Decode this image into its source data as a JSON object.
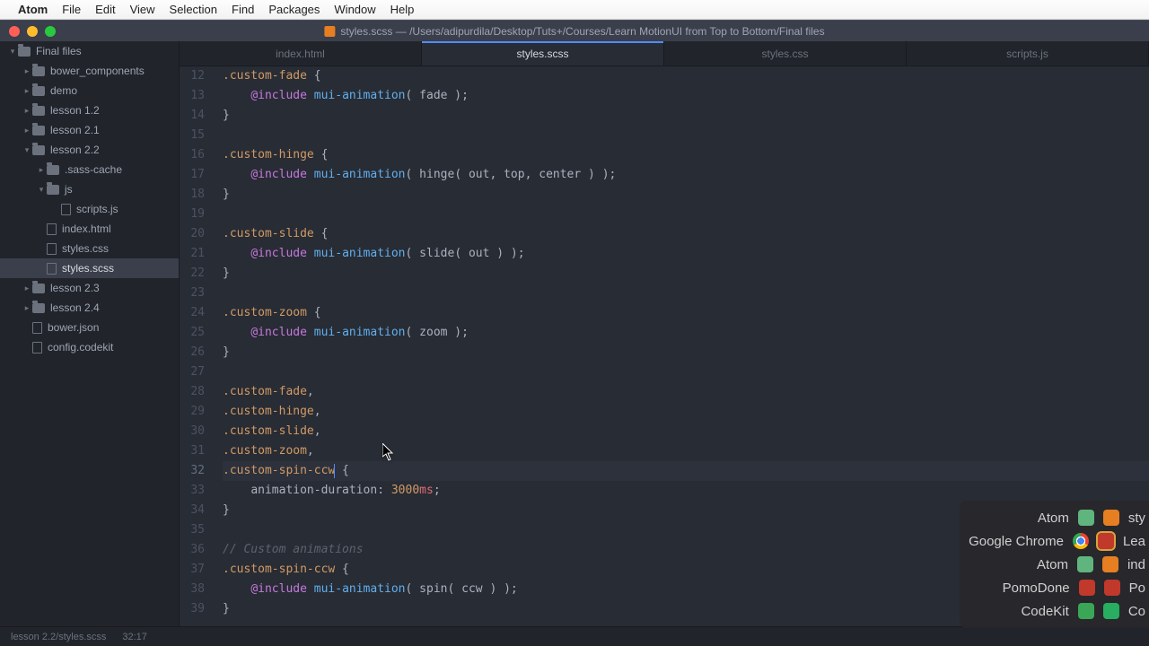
{
  "menubar": {
    "app": "Atom",
    "items": [
      "File",
      "Edit",
      "View",
      "Selection",
      "Find",
      "Packages",
      "Window",
      "Help"
    ]
  },
  "titlebar": {
    "title": "styles.scss — /Users/adipurdila/Desktop/Tuts+/Courses/Learn MotionUI from Top to Bottom/Final files"
  },
  "sidebar": {
    "items": [
      {
        "type": "folder",
        "label": "Final files",
        "indent": 0,
        "open": true
      },
      {
        "type": "folder",
        "label": "bower_components",
        "indent": 1,
        "open": false,
        "chev": true
      },
      {
        "type": "folder",
        "label": "demo",
        "indent": 1,
        "open": false,
        "chev": true
      },
      {
        "type": "folder",
        "label": "lesson 1.2",
        "indent": 1,
        "open": false,
        "chev": true
      },
      {
        "type": "folder",
        "label": "lesson 2.1",
        "indent": 1,
        "open": false,
        "chev": true
      },
      {
        "type": "folder",
        "label": "lesson 2.2",
        "indent": 1,
        "open": true,
        "chev": true
      },
      {
        "type": "folder",
        "label": ".sass-cache",
        "indent": 2,
        "open": false,
        "chev": true
      },
      {
        "type": "folder",
        "label": "js",
        "indent": 2,
        "open": true,
        "chev": true
      },
      {
        "type": "file",
        "label": "scripts.js",
        "indent": 3
      },
      {
        "type": "file",
        "label": "index.html",
        "indent": 2
      },
      {
        "type": "file",
        "label": "styles.css",
        "indent": 2
      },
      {
        "type": "file",
        "label": "styles.scss",
        "indent": 2,
        "sel": true
      },
      {
        "type": "folder",
        "label": "lesson 2.3",
        "indent": 1,
        "open": false,
        "chev": true
      },
      {
        "type": "folder",
        "label": "lesson 2.4",
        "indent": 1,
        "open": false,
        "chev": true
      },
      {
        "type": "file",
        "label": "bower.json",
        "indent": 1
      },
      {
        "type": "file",
        "label": "config.codekit",
        "indent": 1
      }
    ]
  },
  "tabs": [
    {
      "label": "index.html"
    },
    {
      "label": "styles.scss",
      "active": true
    },
    {
      "label": "styles.css"
    },
    {
      "label": "scripts.js"
    }
  ],
  "code": {
    "first_line": 12,
    "lines": [
      {
        "n": 12,
        "seg": [
          {
            "t": ".custom-fade",
            "c": "c-sel"
          },
          {
            "t": " {",
            "c": "c-punc"
          }
        ]
      },
      {
        "n": 13,
        "seg": [
          {
            "t": "    ",
            "c": ""
          },
          {
            "t": "@include",
            "c": "c-key"
          },
          {
            "t": " ",
            "c": ""
          },
          {
            "t": "mui-animation",
            "c": "c-func"
          },
          {
            "t": "( ",
            "c": "c-punc"
          },
          {
            "t": "fade",
            "c": "c-txt"
          },
          {
            "t": " );",
            "c": "c-punc"
          }
        ]
      },
      {
        "n": 14,
        "seg": [
          {
            "t": "}",
            "c": "c-punc"
          }
        ]
      },
      {
        "n": 15,
        "seg": []
      },
      {
        "n": 16,
        "seg": [
          {
            "t": ".custom-hinge",
            "c": "c-sel"
          },
          {
            "t": " {",
            "c": "c-punc"
          }
        ]
      },
      {
        "n": 17,
        "seg": [
          {
            "t": "    ",
            "c": ""
          },
          {
            "t": "@include",
            "c": "c-key"
          },
          {
            "t": " ",
            "c": ""
          },
          {
            "t": "mui-animation",
            "c": "c-func"
          },
          {
            "t": "( ",
            "c": "c-punc"
          },
          {
            "t": "hinge",
            "c": "c-txt"
          },
          {
            "t": "( ",
            "c": "c-punc"
          },
          {
            "t": "out",
            "c": "c-txt"
          },
          {
            "t": ", ",
            "c": "c-punc"
          },
          {
            "t": "top",
            "c": "c-txt"
          },
          {
            "t": ", ",
            "c": "c-punc"
          },
          {
            "t": "center",
            "c": "c-txt"
          },
          {
            "t": " ) );",
            "c": "c-punc"
          }
        ]
      },
      {
        "n": 18,
        "seg": [
          {
            "t": "}",
            "c": "c-punc"
          }
        ]
      },
      {
        "n": 19,
        "seg": []
      },
      {
        "n": 20,
        "seg": [
          {
            "t": ".custom-slide",
            "c": "c-sel"
          },
          {
            "t": " {",
            "c": "c-punc"
          }
        ]
      },
      {
        "n": 21,
        "seg": [
          {
            "t": "    ",
            "c": ""
          },
          {
            "t": "@include",
            "c": "c-key"
          },
          {
            "t": " ",
            "c": ""
          },
          {
            "t": "mui-animation",
            "c": "c-func"
          },
          {
            "t": "( ",
            "c": "c-punc"
          },
          {
            "t": "slide",
            "c": "c-txt"
          },
          {
            "t": "( ",
            "c": "c-punc"
          },
          {
            "t": "out",
            "c": "c-txt"
          },
          {
            "t": " ) );",
            "c": "c-punc"
          }
        ]
      },
      {
        "n": 22,
        "seg": [
          {
            "t": "}",
            "c": "c-punc"
          }
        ]
      },
      {
        "n": 23,
        "seg": []
      },
      {
        "n": 24,
        "seg": [
          {
            "t": ".custom-zoom",
            "c": "c-sel"
          },
          {
            "t": " {",
            "c": "c-punc"
          }
        ]
      },
      {
        "n": 25,
        "seg": [
          {
            "t": "    ",
            "c": ""
          },
          {
            "t": "@include",
            "c": "c-key"
          },
          {
            "t": " ",
            "c": ""
          },
          {
            "t": "mui-animation",
            "c": "c-func"
          },
          {
            "t": "( ",
            "c": "c-punc"
          },
          {
            "t": "zoom",
            "c": "c-txt"
          },
          {
            "t": " );",
            "c": "c-punc"
          }
        ]
      },
      {
        "n": 26,
        "seg": [
          {
            "t": "}",
            "c": "c-punc"
          }
        ]
      },
      {
        "n": 27,
        "seg": []
      },
      {
        "n": 28,
        "seg": [
          {
            "t": ".custom-fade",
            "c": "c-sel"
          },
          {
            "t": ",",
            "c": "c-punc"
          }
        ]
      },
      {
        "n": 29,
        "seg": [
          {
            "t": ".custom-hinge",
            "c": "c-sel"
          },
          {
            "t": ",",
            "c": "c-punc"
          }
        ]
      },
      {
        "n": 30,
        "seg": [
          {
            "t": ".custom-slide",
            "c": "c-sel"
          },
          {
            "t": ",",
            "c": "c-punc"
          }
        ]
      },
      {
        "n": 31,
        "seg": [
          {
            "t": ".custom-zoom",
            "c": "c-sel"
          },
          {
            "t": ",",
            "c": "c-punc"
          }
        ]
      },
      {
        "n": 32,
        "cursor": true,
        "seg": [
          {
            "t": ".custom-spin-ccw",
            "c": "c-sel"
          },
          {
            "t": " {",
            "c": "c-punc"
          }
        ],
        "caret_after": 0
      },
      {
        "n": 33,
        "seg": [
          {
            "t": "    ",
            "c": ""
          },
          {
            "t": "animation-duration",
            "c": "c-prop"
          },
          {
            "t": ": ",
            "c": "c-punc"
          },
          {
            "t": "3000",
            "c": "c-num"
          },
          {
            "t": "ms",
            "c": "c-unit"
          },
          {
            "t": ";",
            "c": "c-punc"
          }
        ]
      },
      {
        "n": 34,
        "seg": [
          {
            "t": "}",
            "c": "c-punc"
          }
        ]
      },
      {
        "n": 35,
        "seg": []
      },
      {
        "n": 36,
        "seg": [
          {
            "t": "// Custom animations",
            "c": "c-comment"
          }
        ]
      },
      {
        "n": 37,
        "seg": [
          {
            "t": ".custom-spin-ccw",
            "c": "c-sel"
          },
          {
            "t": " {",
            "c": "c-punc"
          }
        ]
      },
      {
        "n": 38,
        "seg": [
          {
            "t": "    ",
            "c": ""
          },
          {
            "t": "@include",
            "c": "c-key"
          },
          {
            "t": " ",
            "c": ""
          },
          {
            "t": "mui-animation",
            "c": "c-func"
          },
          {
            "t": "( ",
            "c": "c-punc"
          },
          {
            "t": "spin",
            "c": "c-txt"
          },
          {
            "t": "( ",
            "c": "c-punc"
          },
          {
            "t": "ccw",
            "c": "c-txt"
          },
          {
            "t": " ) );",
            "c": "c-punc"
          }
        ]
      },
      {
        "n": 39,
        "seg": [
          {
            "t": "}",
            "c": "c-punc"
          }
        ]
      }
    ]
  },
  "statusbar": {
    "path": "lesson 2.2/styles.scss",
    "pos": "32:17"
  },
  "switcher": [
    {
      "app": "Atom",
      "icon": "ic-atom",
      "sub": "sub-orange",
      "doc": "sty"
    },
    {
      "app": "Google Chrome",
      "icon": "ic-chrome",
      "sub": "sub-red",
      "doc": "Lea",
      "sel": true
    },
    {
      "app": "Atom",
      "icon": "ic-atom",
      "sub": "sub-orange",
      "doc": "ind"
    },
    {
      "app": "PomoDone",
      "icon": "ic-pomo",
      "sub": "sub-red",
      "doc": "Po"
    },
    {
      "app": "CodeKit",
      "icon": "ic-codekit",
      "sub": "sub-green",
      "doc": "Co"
    }
  ]
}
